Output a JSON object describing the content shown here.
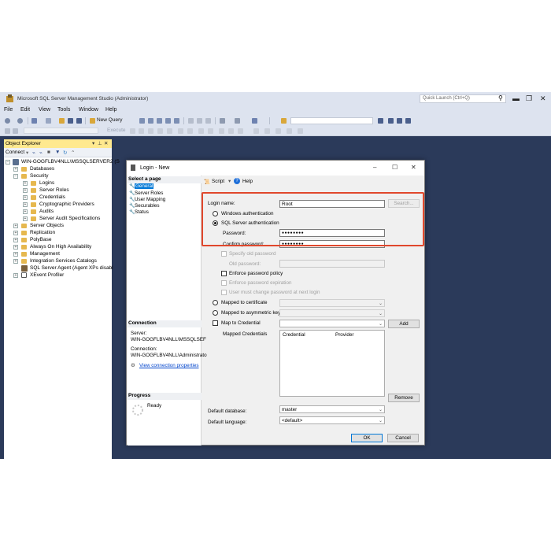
{
  "app": {
    "title": "Microsoft SQL Server Management Studio (Administrator)",
    "quick_launch_placeholder": "Quick Launch (Ctrl+Q)",
    "menu": [
      "File",
      "Edit",
      "View",
      "Tools",
      "Window",
      "Help"
    ],
    "new_query": "New Query",
    "execute": "Execute"
  },
  "object_explorer": {
    "title": "Object Explorer",
    "connect_label": "Connect",
    "nodes": [
      {
        "label": "WIN-GOGFLBV4NLL\\MSSQLSERVER2 (S"
      },
      {
        "label": "Databases"
      },
      {
        "label": "Security"
      },
      {
        "label": "Logins"
      },
      {
        "label": "Server Roles"
      },
      {
        "label": "Credentials"
      },
      {
        "label": "Cryptographic Providers"
      },
      {
        "label": "Audits"
      },
      {
        "label": "Server Audit Specifications"
      },
      {
        "label": "Server Objects"
      },
      {
        "label": "Replication"
      },
      {
        "label": "PolyBase"
      },
      {
        "label": "Always On High Availability"
      },
      {
        "label": "Management"
      },
      {
        "label": "Integration Services Catalogs"
      },
      {
        "label": "SQL Server Agent (Agent XPs disabl"
      },
      {
        "label": "XEvent Profiler"
      }
    ]
  },
  "dialog": {
    "title": "Login - New",
    "select_page": "Select a page",
    "pages": [
      "General",
      "Server Roles",
      "User Mapping",
      "Securables",
      "Status"
    ],
    "connection_header": "Connection",
    "server_label": "Server:",
    "server_value": "WIN-GOGFLBV4NLL\\MSSQLSEF",
    "connection_label": "Connection:",
    "connection_value": "WIN-GOGFLBV4NLL\\Administrato",
    "view_connection": "View connection properties",
    "progress_header": "Progress",
    "progress_status": "Ready",
    "script_label": "Script",
    "help_label": "Help",
    "login_name_label": "Login name:",
    "login_name_value": "Root",
    "search_button": "Search...",
    "windows_auth": "Windows authentication",
    "sql_auth": "SQL Server authentication",
    "password_label": "Password:",
    "password_value": "●●●●●●●●",
    "confirm_password_label": "Confirm password:",
    "confirm_password_value": "●●●●●●●●",
    "specify_old": "Specify old password",
    "old_password_label": "Old password:",
    "enforce_policy": "Enforce password policy",
    "enforce_expiration": "Enforce password expiration",
    "must_change": "User must change password at next login",
    "mapped_cert": "Mapped to certificate",
    "mapped_asym": "Mapped to asymmetric key",
    "map_credential": "Map to Credential",
    "add_button": "Add",
    "mapped_credentials_label": "Mapped Credentials",
    "col_credential": "Credential",
    "col_provider": "Provider",
    "remove_button": "Remove",
    "default_db_label": "Default database:",
    "default_db_value": "master",
    "default_lang_label": "Default language:",
    "default_lang_value": "<default>",
    "ok_button": "OK",
    "cancel_button": "Cancel"
  },
  "colors": {
    "highlight": "#e0472c",
    "accent": "#0078d7",
    "oe_header": "#ffe98f",
    "shell": "#2b3a5a"
  }
}
